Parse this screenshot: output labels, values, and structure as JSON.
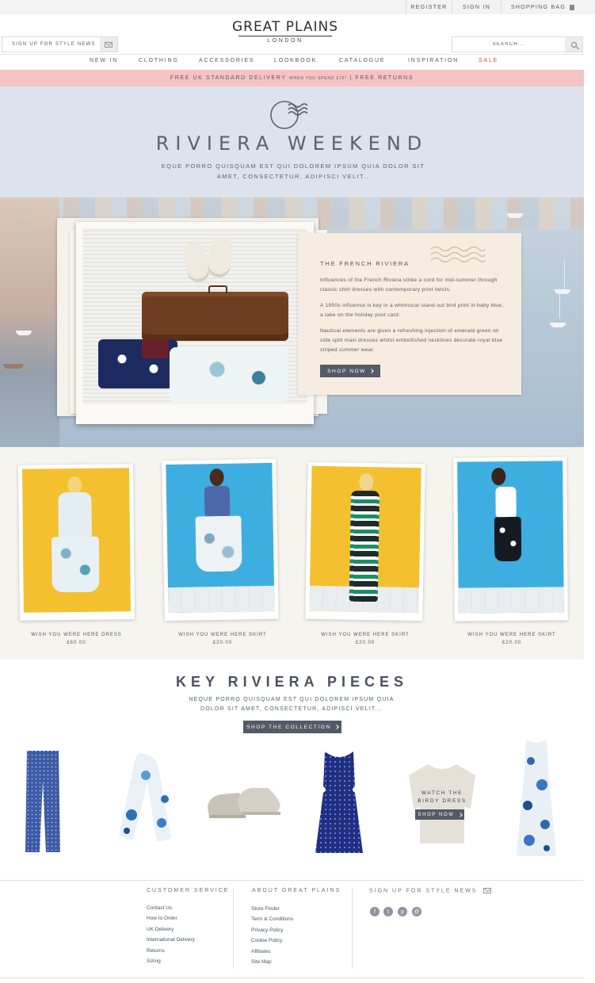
{
  "topbar": {
    "register": "REGISTER",
    "sign_in": "SIGN IN",
    "shopping_bag": "SHOPPING BAG"
  },
  "header": {
    "brand": "GREAT PLAINS",
    "brand_sub": "LONDON",
    "signup_label": "SIGN UP FOR STYLE NEWS",
    "search_placeholder": "SEARCH..."
  },
  "nav": [
    "NEW IN",
    "CLOTHING",
    "ACCESSORIES",
    "LOOKBOOK",
    "CATALOGUE",
    "INSPIRATION",
    "SALE"
  ],
  "promo": {
    "main": "FREE UK STANDARD DELIVERY",
    "small": "WHEN YOU SPEND £75*",
    "sep": " | ",
    "returns": "FREE RETURNS"
  },
  "hero": {
    "title": "RIVIERA WEEKEND",
    "lede": "EQUE PORRO QUISQUAM EST QUI DOLOREM IPSUM QUIA DOLOR SIT AMET, CONSECTETUR, ADIPISCI VELIT.."
  },
  "feature": {
    "title": "THE FRENCH RIVIERA",
    "paragraphs": [
      "Influences of the French Riviera strike a cord for mid-summer through classic shirt dresses with contemporary print twists.",
      "A 1950s influence is key in a whimsical stand out bird print in baby blue, a take on the holiday post card.",
      "Nautical elements are given a refreshing injection of emerald green on side split maxi dresses whilst embellished necklines decorate royal blue striped summer wear."
    ],
    "cta": "SHOP NOW"
  },
  "products": [
    {
      "name": "WISH YOU WERE HERE DRESS",
      "price": "£60.00"
    },
    {
      "name": "WISH YOU WERE HERE SKIRT",
      "price": "£20.00"
    },
    {
      "name": "WISH YOU WERE HERE SKIRT",
      "price": "£20.00"
    },
    {
      "name": "WISH YOU WERE HERE SKIRT",
      "price": "£20.00"
    }
  ],
  "key_pieces": {
    "title": "KEY RIVIERA PIECES",
    "lede": "NEQUE PORRO QUISQUAM EST QUI DOLOREM IPSUM QUIA DOLOR SIT AMET, CONSECTETUR, ADIPISCI VELIT...",
    "cta": "SHOP THE COLLECTION",
    "overlay_line1": "WATCH THE",
    "overlay_line2": "BIRDY DRESS",
    "overlay_cta": "SHOP NOW"
  },
  "footer": {
    "customer_service_title": "CUSTOMER SERVICE",
    "customer_service_links": [
      "Contact Us",
      "How to Order",
      "UK Delivery",
      "International Delivery",
      "Returns",
      "Sizing"
    ],
    "about_title": "ABOUT GREAT PLAINS",
    "about_links": [
      "Store Finder",
      "Term & Conditions",
      "Privacy Policy",
      "Cookie Policy",
      "Affiliates",
      "Site Map"
    ],
    "signup_title": "SIGN UP FOR STYLE NEWS",
    "social_icons": [
      "facebook-icon",
      "twitter-icon",
      "pinterest-icon",
      "email-icon"
    ]
  },
  "colors": {
    "promo_bg": "#f6c3c3",
    "hero_bg": "#dce3ec",
    "button": "#545a66",
    "sale": "#e0433a",
    "card_bg": "#f6ede0"
  }
}
